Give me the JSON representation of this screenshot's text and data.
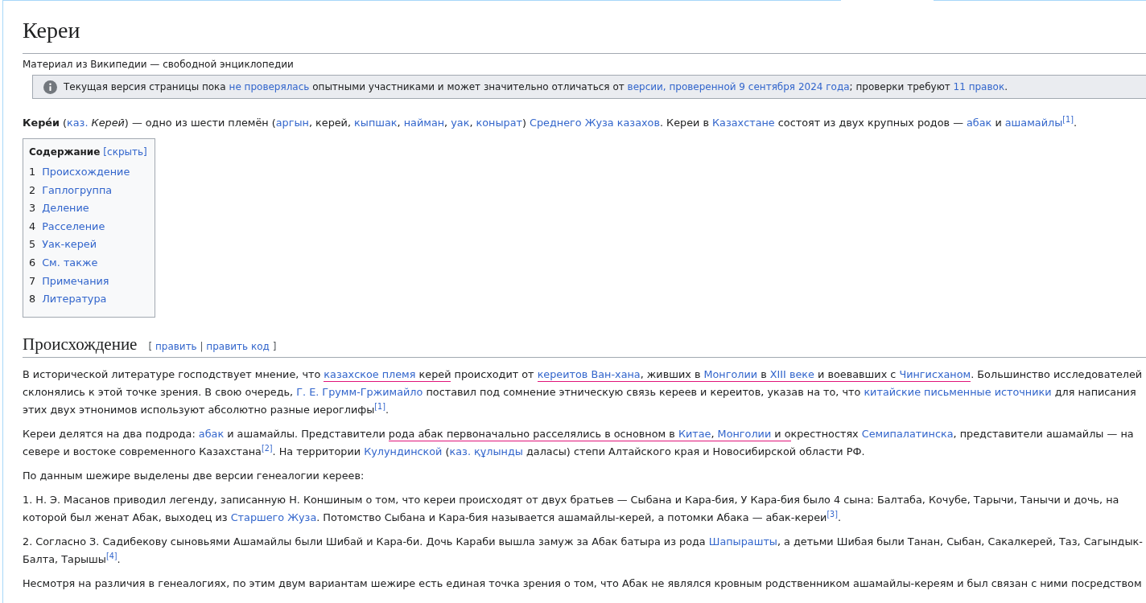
{
  "page": {
    "title": "Кереи",
    "tagline": "Материал из Википедии — свободной энциклопедии"
  },
  "notice": {
    "runs": [
      {
        "kind": "text",
        "text": "Текущая версия страницы пока "
      },
      {
        "kind": "link",
        "text": "не проверялась"
      },
      {
        "kind": "text",
        "text": " опытными участниками и может значительно отличаться от "
      },
      {
        "kind": "link",
        "text": "версии, проверенной 9 сентября 2024 года"
      },
      {
        "kind": "text",
        "text": "; проверки требуют "
      },
      {
        "kind": "link",
        "text": "11 правок"
      },
      {
        "kind": "text",
        "text": "."
      }
    ]
  },
  "intro": {
    "runs": [
      {
        "kind": "text",
        "text": "**Кере́и** ("
      },
      {
        "kind": "link",
        "text": "каз."
      },
      {
        "kind": "text",
        "text": " *Керей*) — одно из шести племён ("
      },
      {
        "kind": "link",
        "text": "аргын"
      },
      {
        "kind": "text",
        "text": ", керей, "
      },
      {
        "kind": "link",
        "text": "кыпшак"
      },
      {
        "kind": "text",
        "text": ", "
      },
      {
        "kind": "link",
        "text": "найман"
      },
      {
        "kind": "text",
        "text": ", "
      },
      {
        "kind": "link",
        "text": "уак"
      },
      {
        "kind": "text",
        "text": ", "
      },
      {
        "kind": "link",
        "text": "конырат"
      },
      {
        "kind": "text",
        "text": ") "
      },
      {
        "kind": "link",
        "text": "Среднего Жуза казахов"
      },
      {
        "kind": "text",
        "text": ". Кереи в "
      },
      {
        "kind": "link",
        "text": "Казахстане"
      },
      {
        "kind": "text",
        "text": " состоят из двух крупных родов — "
      },
      {
        "kind": "link",
        "text": "абак"
      },
      {
        "kind": "text",
        "text": " и "
      },
      {
        "kind": "link",
        "text": "ашамайлы"
      },
      {
        "kind": "ref",
        "text": "[1]"
      },
      {
        "kind": "text",
        "text": "."
      }
    ]
  },
  "toc": {
    "title": "Содержание",
    "toggle": "[скрыть]",
    "items": [
      {
        "number": "1",
        "title": "Происхождение"
      },
      {
        "number": "2",
        "title": "Гаплогруппа"
      },
      {
        "number": "3",
        "title": "Деление"
      },
      {
        "number": "4",
        "title": "Расселение"
      },
      {
        "number": "5",
        "title": "Уак-керей"
      },
      {
        "number": "6",
        "title": "См. также"
      },
      {
        "number": "7",
        "title": "Примечания"
      },
      {
        "number": "8",
        "title": "Литература"
      }
    ]
  },
  "sections": [
    {
      "heading": "Происхождение",
      "edit_links": [
        {
          "kind": "text",
          "text": "[ "
        },
        {
          "kind": "link",
          "text": "править"
        },
        {
          "kind": "text",
          "text": " | "
        },
        {
          "kind": "link",
          "text": "править код"
        },
        {
          "kind": "text",
          "text": " ]"
        }
      ],
      "paragraphs": [
        {
          "runs": [
            {
              "kind": "text",
              "text": "В исторической литературе господствует мнение, что ",
              "underlined": false
            },
            {
              "kind": "link",
              "text": "казахское племя",
              "underlined": true
            },
            {
              "kind": "text",
              "text": " керей",
              "underlined": true
            },
            {
              "kind": "text",
              "text": " происходит от ",
              "underlined": false
            },
            {
              "kind": "link",
              "text": "кереитов Ван-хана",
              "underlined": true
            },
            {
              "kind": "text",
              "text": ", живших в ",
              "underlined": true
            },
            {
              "kind": "link",
              "text": "Монголии",
              "underlined": true
            },
            {
              "kind": "text",
              "text": " в ",
              "underlined": true
            },
            {
              "kind": "link",
              "text": "XIII веке",
              "underlined": true
            },
            {
              "kind": "text",
              "text": " и воевавших с ",
              "underlined": true
            },
            {
              "kind": "link",
              "text": "Чингисханом",
              "underlined": true
            },
            {
              "kind": "text",
              "text": ". Большинство исследователей склонялись к этой точке зрения. В свою очередь, ",
              "underlined": false
            },
            {
              "kind": "link",
              "text": "Г. Е. Грумм-Гржимайло",
              "underlined": false
            },
            {
              "kind": "text",
              "text": " поставил под сомнение этническую связь кереев и кереитов, указав на то, что ",
              "underlined": false
            },
            {
              "kind": "link",
              "text": "китайские письменные источники",
              "underlined": false
            },
            {
              "kind": "text",
              "text": " для написания этих двух этнонимов используют абсолютно разные иероглифы",
              "underlined": false
            },
            {
              "kind": "ref",
              "text": "[1]",
              "underlined": false
            },
            {
              "kind": "text",
              "text": ".",
              "underlined": false
            }
          ]
        },
        {
          "runs": [
            {
              "kind": "text",
              "text": "Кереи делятся на два подрода: ",
              "underlined": false
            },
            {
              "kind": "link",
              "text": "абак",
              "underlined": false
            },
            {
              "kind": "text",
              "text": " и ашамайлы. Представители ",
              "underlined": false
            },
            {
              "kind": "text",
              "text": "рода абак первоначально расселялись в основном в ",
              "underlined": true
            },
            {
              "kind": "link",
              "text": "Китае",
              "underlined": true
            },
            {
              "kind": "text",
              "text": ", ",
              "underlined": true
            },
            {
              "kind": "link",
              "text": "Монголии",
              "underlined": true
            },
            {
              "kind": "text",
              "text": " и о",
              "underlined": true
            },
            {
              "kind": "text",
              "text": "крестностях ",
              "underlined": false
            },
            {
              "kind": "link",
              "text": "Семипалатинска",
              "underlined": false
            },
            {
              "kind": "text",
              "text": ", представители ашамайлы — на севере и востоке современного Казахстана",
              "underlined": false
            },
            {
              "kind": "ref",
              "text": "[2]",
              "underlined": false
            },
            {
              "kind": "text",
              "text": ". На территории ",
              "underlined": false
            },
            {
              "kind": "link",
              "text": "Кулундинской",
              "underlined": false
            },
            {
              "kind": "text",
              "text": " (",
              "underlined": false
            },
            {
              "kind": "link",
              "text": "каз. құлынды",
              "underlined": false
            },
            {
              "kind": "text",
              "text": " даласы) степи Алтайского края и Новосибирской области РФ.",
              "underlined": false
            }
          ]
        },
        {
          "runs": [
            {
              "kind": "text",
              "text": "По данным шежире выделены две версии генеалогии кереев:"
            }
          ]
        },
        {
          "runs": [
            {
              "kind": "text",
              "text": "1. Н. Э. Масанов приводил легенду, записанную Н. Коншиным о том, что кереи происходят от двух братьев — Сыбана и Кара-бия, У Кара-бия было 4 сына: Балтаба, Кочубе, Тарычи, Танычи и дочь, на которой был женат Абак, выходец из "
            },
            {
              "kind": "link",
              "text": "Старшего Жуза"
            },
            {
              "kind": "text",
              "text": ". Потомство Сыбана и Кара-бия называется ашамайлы-керей, а потомки Абака — абак-кереи"
            },
            {
              "kind": "ref",
              "text": "[3]"
            },
            {
              "kind": "text",
              "text": "."
            }
          ]
        },
        {
          "runs": [
            {
              "kind": "text",
              "text": "2. Согласно З. Садибекову сыновьями Ашамайлы были Шибай и Кара-би. Дочь Караби вышла замуж за Абак батыра из рода "
            },
            {
              "kind": "link",
              "text": "Шапырашты"
            },
            {
              "kind": "text",
              "text": ", а детьми Шибая были Танан, Сыбан, Сакалкерей, Таз, Сагындык-Балта, Тарышы"
            },
            {
              "kind": "ref",
              "text": "[4]"
            },
            {
              "kind": "text",
              "text": "."
            }
          ]
        },
        {
          "runs": [
            {
              "kind": "text",
              "text": "Несмотря на различия в генеалогиях, по этим двум вариантам шежире есть единая точка зрения о том, что Абак не являлся кровным родственником ашамайлы-кереям и был связан с ними посредством"
            }
          ]
        }
      ]
    }
  ]
}
